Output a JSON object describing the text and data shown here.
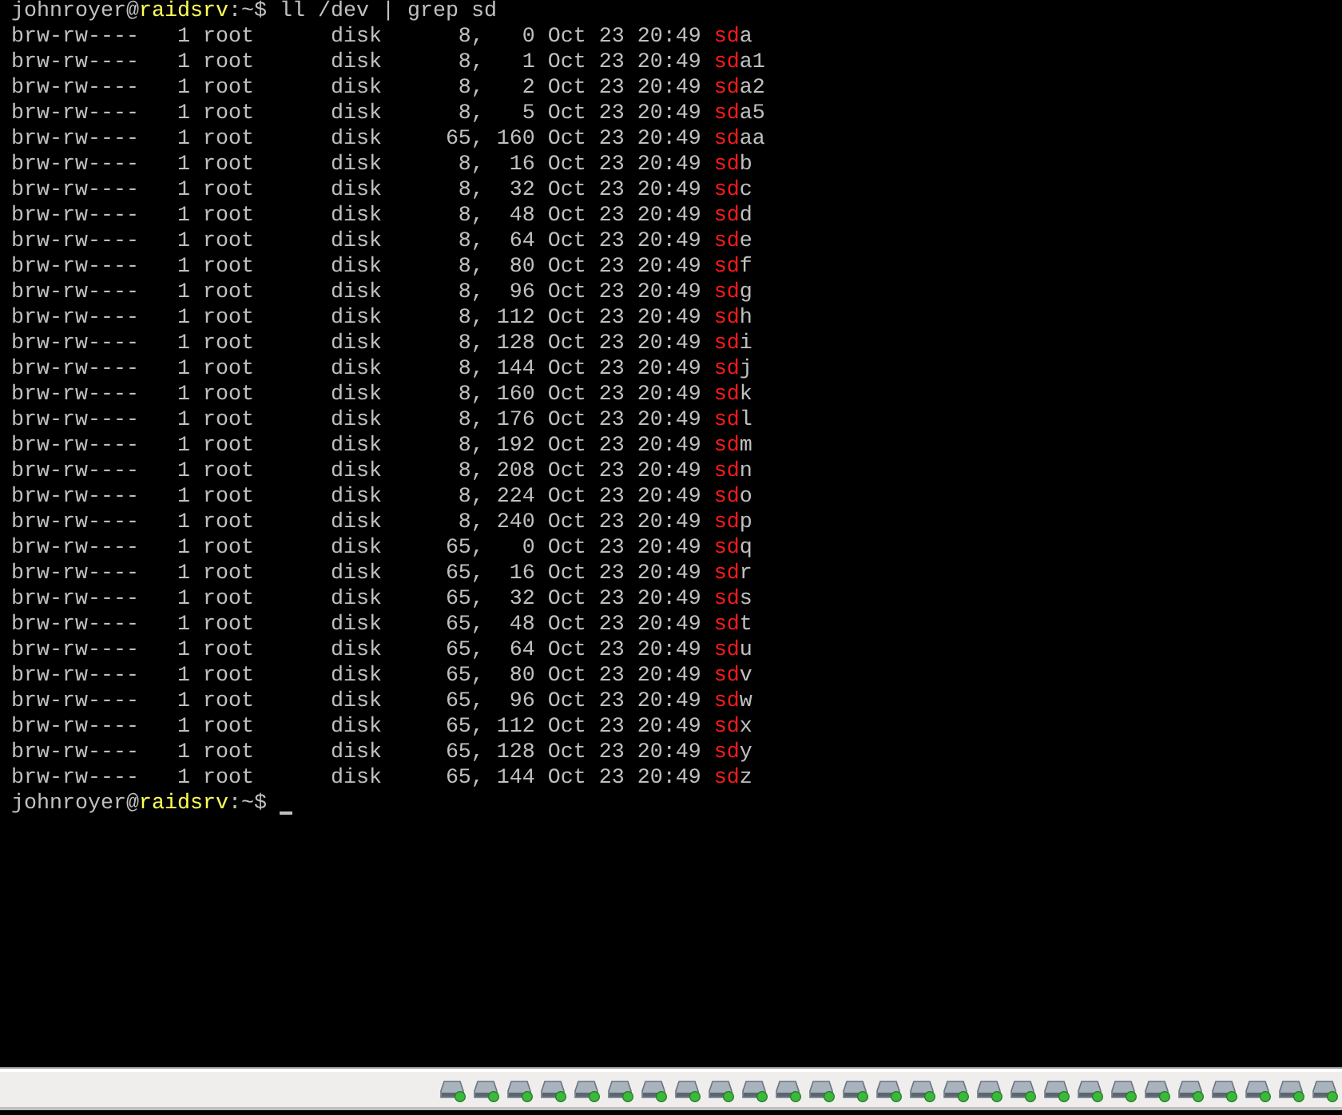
{
  "terminal": {
    "command_prompt": {
      "user": "johnroyer",
      "at": "@",
      "host": "raidsrv",
      "path": ":~$ ",
      "command": "ll /dev | grep sd"
    },
    "lines": [
      {
        "text": "brw-rw----   1 root      disk      8,   0 Oct 23 20:49 ",
        "match": "sd",
        "rest": "a"
      },
      {
        "text": "brw-rw----   1 root      disk      8,   1 Oct 23 20:49 ",
        "match": "sd",
        "rest": "a1"
      },
      {
        "text": "brw-rw----   1 root      disk      8,   2 Oct 23 20:49 ",
        "match": "sd",
        "rest": "a2"
      },
      {
        "text": "brw-rw----   1 root      disk      8,   5 Oct 23 20:49 ",
        "match": "sd",
        "rest": "a5"
      },
      {
        "text": "brw-rw----   1 root      disk     65, 160 Oct 23 20:49 ",
        "match": "sd",
        "rest": "aa"
      },
      {
        "text": "brw-rw----   1 root      disk      8,  16 Oct 23 20:49 ",
        "match": "sd",
        "rest": "b"
      },
      {
        "text": "brw-rw----   1 root      disk      8,  32 Oct 23 20:49 ",
        "match": "sd",
        "rest": "c"
      },
      {
        "text": "brw-rw----   1 root      disk      8,  48 Oct 23 20:49 ",
        "match": "sd",
        "rest": "d"
      },
      {
        "text": "brw-rw----   1 root      disk      8,  64 Oct 23 20:49 ",
        "match": "sd",
        "rest": "e"
      },
      {
        "text": "brw-rw----   1 root      disk      8,  80 Oct 23 20:49 ",
        "match": "sd",
        "rest": "f"
      },
      {
        "text": "brw-rw----   1 root      disk      8,  96 Oct 23 20:49 ",
        "match": "sd",
        "rest": "g"
      },
      {
        "text": "brw-rw----   1 root      disk      8, 112 Oct 23 20:49 ",
        "match": "sd",
        "rest": "h"
      },
      {
        "text": "brw-rw----   1 root      disk      8, 128 Oct 23 20:49 ",
        "match": "sd",
        "rest": "i"
      },
      {
        "text": "brw-rw----   1 root      disk      8, 144 Oct 23 20:49 ",
        "match": "sd",
        "rest": "j"
      },
      {
        "text": "brw-rw----   1 root      disk      8, 160 Oct 23 20:49 ",
        "match": "sd",
        "rest": "k"
      },
      {
        "text": "brw-rw----   1 root      disk      8, 176 Oct 23 20:49 ",
        "match": "sd",
        "rest": "l"
      },
      {
        "text": "brw-rw----   1 root      disk      8, 192 Oct 23 20:49 ",
        "match": "sd",
        "rest": "m"
      },
      {
        "text": "brw-rw----   1 root      disk      8, 208 Oct 23 20:49 ",
        "match": "sd",
        "rest": "n"
      },
      {
        "text": "brw-rw----   1 root      disk      8, 224 Oct 23 20:49 ",
        "match": "sd",
        "rest": "o"
      },
      {
        "text": "brw-rw----   1 root      disk      8, 240 Oct 23 20:49 ",
        "match": "sd",
        "rest": "p"
      },
      {
        "text": "brw-rw----   1 root      disk     65,   0 Oct 23 20:49 ",
        "match": "sd",
        "rest": "q"
      },
      {
        "text": "brw-rw----   1 root      disk     65,  16 Oct 23 20:49 ",
        "match": "sd",
        "rest": "r"
      },
      {
        "text": "brw-rw----   1 root      disk     65,  32 Oct 23 20:49 ",
        "match": "sd",
        "rest": "s"
      },
      {
        "text": "brw-rw----   1 root      disk     65,  48 Oct 23 20:49 ",
        "match": "sd",
        "rest": "t"
      },
      {
        "text": "brw-rw----   1 root      disk     65,  64 Oct 23 20:49 ",
        "match": "sd",
        "rest": "u"
      },
      {
        "text": "brw-rw----   1 root      disk     65,  80 Oct 23 20:49 ",
        "match": "sd",
        "rest": "v"
      },
      {
        "text": "brw-rw----   1 root      disk     65,  96 Oct 23 20:49 ",
        "match": "sd",
        "rest": "w"
      },
      {
        "text": "brw-rw----   1 root      disk     65, 112 Oct 23 20:49 ",
        "match": "sd",
        "rest": "x"
      },
      {
        "text": "brw-rw----   1 root      disk     65, 128 Oct 23 20:49 ",
        "match": "sd",
        "rest": "y"
      },
      {
        "text": "brw-rw----   1 root      disk     65, 144 Oct 23 20:49 ",
        "match": "sd",
        "rest": "z"
      }
    ],
    "final_prompt": {
      "user": "johnroyer",
      "at": "@",
      "host": "raidsrv",
      "path": ":~$ ",
      "cursor": true
    }
  },
  "status_bar": {
    "devices": [
      {
        "kind": "hard-disk"
      },
      {
        "kind": "hard-disk"
      },
      {
        "kind": "hard-disk"
      },
      {
        "kind": "hard-disk"
      },
      {
        "kind": "hard-disk"
      },
      {
        "kind": "hard-disk"
      },
      {
        "kind": "hard-disk"
      },
      {
        "kind": "hard-disk"
      },
      {
        "kind": "hard-disk"
      },
      {
        "kind": "hard-disk"
      },
      {
        "kind": "hard-disk"
      },
      {
        "kind": "hard-disk"
      },
      {
        "kind": "hard-disk"
      },
      {
        "kind": "hard-disk"
      },
      {
        "kind": "hard-disk"
      },
      {
        "kind": "hard-disk"
      },
      {
        "kind": "hard-disk"
      },
      {
        "kind": "hard-disk"
      },
      {
        "kind": "hard-disk"
      },
      {
        "kind": "hard-disk"
      },
      {
        "kind": "hard-disk"
      },
      {
        "kind": "hard-disk"
      },
      {
        "kind": "hard-disk"
      },
      {
        "kind": "hard-disk"
      },
      {
        "kind": "hard-disk"
      },
      {
        "kind": "hard-disk"
      },
      {
        "kind": "hard-disk"
      }
    ]
  }
}
